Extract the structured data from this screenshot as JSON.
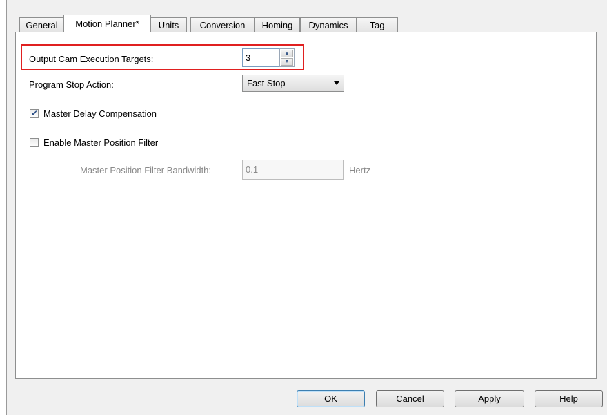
{
  "tabs": [
    {
      "label": "General"
    },
    {
      "label": "Motion Planner*"
    },
    {
      "label": "Units"
    },
    {
      "label": "Conversion"
    },
    {
      "label": "Homing"
    },
    {
      "label": "Dynamics"
    },
    {
      "label": "Tag"
    }
  ],
  "active_tab": "Motion Planner*",
  "form": {
    "output_cam_label": "Output Cam Execution Targets:",
    "output_cam_value": "3",
    "program_stop_label": "Program Stop Action:",
    "program_stop_value": "Fast Stop",
    "master_delay_label": "Master Delay Compensation",
    "master_delay_checked": true,
    "enable_filter_label": "Enable Master Position Filter",
    "enable_filter_checked": false,
    "bandwidth_label": "Master Position Filter Bandwidth:",
    "bandwidth_value": "0.1",
    "bandwidth_unit": "Hertz"
  },
  "buttons": {
    "ok": "OK",
    "cancel": "Cancel",
    "apply": "Apply",
    "help": "Help"
  },
  "colors": {
    "highlight": "#e02020",
    "accent": "#3c7fb1"
  }
}
